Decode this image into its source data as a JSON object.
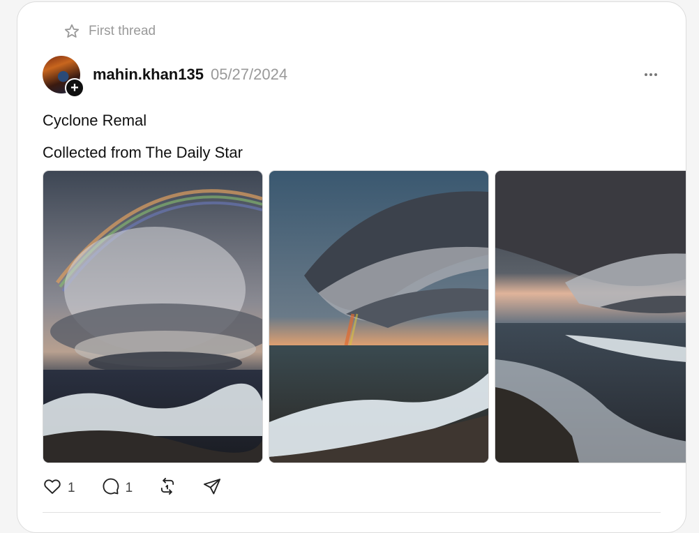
{
  "pinned": {
    "label": "First thread",
    "icon": "star-icon"
  },
  "post": {
    "username": "mahin.khan135",
    "date": "05/27/2024",
    "lines": [
      "Cyclone Remal",
      "Collected from The Daily Star"
    ],
    "images": [
      {
        "description": "supercell storm with rainbow over ocean waves"
      },
      {
        "description": "shelf cloud with rainbow at sunset over beach"
      },
      {
        "description": "storm cloud over crashing waves on shore"
      }
    ],
    "actions": {
      "like": {
        "icon": "heart-icon",
        "count": "1"
      },
      "reply": {
        "icon": "comment-icon",
        "count": "1"
      },
      "repost": {
        "icon": "repost-icon"
      },
      "share": {
        "icon": "send-icon"
      }
    }
  },
  "colors": {
    "muted": "#999999",
    "text": "#101010",
    "border": "#dcdcdc"
  }
}
